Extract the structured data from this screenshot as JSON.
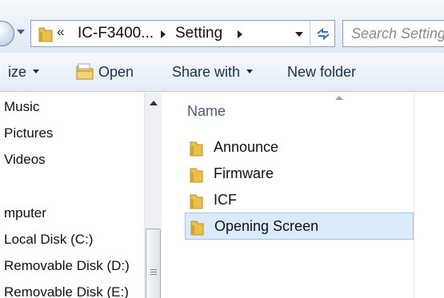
{
  "address_bar": {
    "overflow_chevron": "«",
    "path": [
      "IC-F3400...",
      "Setting"
    ],
    "refresh_glyph": "⁺↔"
  },
  "search": {
    "placeholder": "Search Setting"
  },
  "toolbar": {
    "organize_label": "ize",
    "open_label": "Open",
    "share_label": "Share with",
    "new_folder_label": "New folder"
  },
  "navigation": {
    "items": [
      "Music",
      "Pictures",
      "Videos",
      "mputer",
      "Local Disk (C:)",
      "Removable Disk (D:)",
      "Removable Disk (E:)"
    ]
  },
  "content": {
    "column_header": "Name",
    "folders": [
      "Announce",
      "Firmware",
      "ICF",
      "Opening Screen"
    ],
    "selected_folder": "Opening Screen"
  },
  "colors": {
    "folder": "#e8c04a",
    "selection": "#dcebfc",
    "selection_border": "#9fc4ee"
  }
}
